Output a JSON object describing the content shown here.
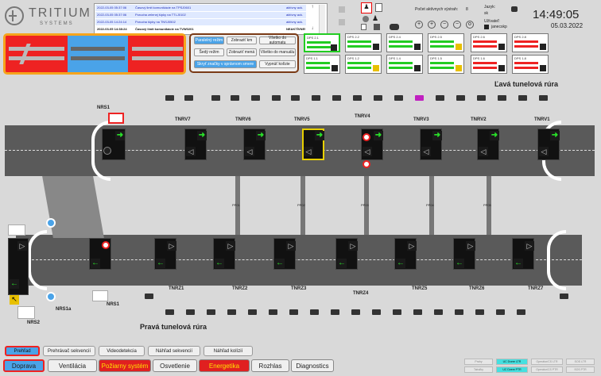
{
  "brand": {
    "name": "TRITIUM",
    "sub": "SYSTEMS"
  },
  "alerts": [
    {
      "time": "2022-03-05 05:37:06",
      "text": "Časový limit komunikácie na TPSJ0601",
      "state": "aktívny ack."
    },
    {
      "time": "2022-03-05 05:37:06",
      "text": "Porucha zelenej šípky na TTLJ0102",
      "state": "aktívny ack."
    },
    {
      "time": "2022-03-05 14:24:14",
      "text": "Porucha šípky na TNSJ0502",
      "state": "aktívny ack."
    },
    {
      "time": "2022-03-05 14:38:24",
      "text": "Časový limit komunikácie na TVW0201",
      "state": "NEAKTÍVNE!"
    }
  ],
  "header": {
    "active_count_label": "Počet aktívnych výstrah:",
    "active_count": "8",
    "lang_label": "Jazyk:",
    "lang": "sk",
    "user_label": "Užívateľ:",
    "user": "janecskp",
    "time": "14:49:05",
    "date": "05.03.2022"
  },
  "controls": [
    "Paralelný režim",
    "Zobraziť km",
    "Všetko do automatu",
    "Šedý režim",
    "Zobraziť mená",
    "Všetko do manuálu",
    "Skryť značky v správnom smere",
    "Vypnúť kolízie"
  ],
  "dps": [
    "DPS 2.1",
    "DPS 2.2",
    "DPS 2.4",
    "DPS 2.5",
    "DPS 2.6",
    "DPS 2.8",
    "DPS 1.1",
    "DPS 1.2",
    "DPS 1.4",
    "DPS 1.5",
    "DPS 1.6",
    "DPS 1.8"
  ],
  "tunnel": {
    "left_title": "Ľavá tunelová rúra",
    "right_title": "Pravá tunelová rúra",
    "left_labels": [
      "TNRV7",
      "TNRV6",
      "TNRV5",
      "TNRV4",
      "TNRV3",
      "TNRV2",
      "TNRV1"
    ],
    "right_labels": [
      "TNRZ1",
      "TNRZ2",
      "TNRZ3",
      "TNRZ4",
      "TNRZ5",
      "TNRZ6",
      "TNRZ7"
    ],
    "pp": [
      "PP01",
      "PP02",
      "PP03",
      "PP04",
      "PP05"
    ],
    "nrs": [
      "NRS1",
      "NRS2",
      "NRS1a",
      "NRS1"
    ]
  },
  "nav_tabs": [
    "Prehľad",
    "Prehrávač sekvencií",
    "Videodetekcia",
    "Náhľad sekvencií",
    "Náhľad kolízií"
  ],
  "bottom_tabs": [
    "Doprava",
    "Ventilácia",
    "Požiarny systém",
    "Osvetlenie",
    "Energetika",
    "Rozhlas",
    "Diagnostics"
  ],
  "status_tabs": [
    "Prahy",
    "UC Dvere LTR",
    "Operátor/CS LTR",
    "SOS LTR",
    "Tabuľky",
    "UC Dvere PTR",
    "Operátor/CS PTR",
    "SOS PTR"
  ],
  "colors": {
    "accent": "#e02020",
    "blue": "#4aa3e8",
    "road": "#555555"
  }
}
